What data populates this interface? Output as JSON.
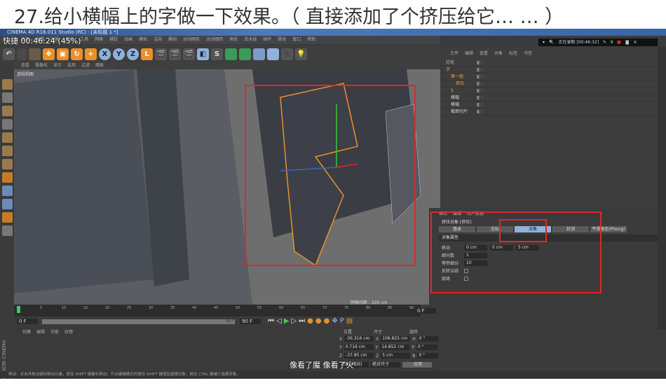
{
  "caption": "27.给小横幅上的字做一下效果。（ 直接添加了个挤压给它… … ）",
  "window_title": "CINEMA 4D R16.011 Studio (RC) - [未标题 1 *]",
  "overlay": "快捷  00:46:24 (45%)",
  "menu": [
    "文件",
    "编辑",
    "创建",
    "选择",
    "工具",
    "网格",
    "捕捉",
    "动画",
    "模拟",
    "渲染",
    "雕刻",
    "运动图形",
    "运动跟踪",
    "角色",
    "流水线",
    "插件",
    "脚本",
    "窗口",
    "帮助"
  ],
  "recording": {
    "label": "正在录制 [00:46:32]"
  },
  "viewport": {
    "menu": [
      "查看",
      "摄像机",
      "显示",
      "选项",
      "过滤",
      "面板"
    ],
    "label": "透视视图",
    "grid": "网格间距 : 100 cm"
  },
  "object_manager": {
    "menu": [
      "文件",
      "编辑",
      "查看",
      "对象",
      "标签",
      "书签"
    ],
    "objects": [
      {
        "name": "灯光",
        "indent": 0
      },
      {
        "name": "字",
        "indent": 0,
        "selected": true
      },
      {
        "name": "第一组",
        "indent": 1,
        "selected": true
      },
      {
        "name": "挤压",
        "indent": 2,
        "selected": true
      },
      {
        "name": "1",
        "indent": 1
      },
      {
        "name": "横幅",
        "indent": 1
      },
      {
        "name": "横幅",
        "indent": 1
      },
      {
        "name": "截面切片",
        "indent": 1
      }
    ]
  },
  "attributes": {
    "menu": [
      "模式",
      "编辑",
      "用户数据"
    ],
    "title": "挤压对象 [挤压]",
    "tabs": [
      {
        "label": "基本"
      },
      {
        "label": "坐标"
      },
      {
        "label": "对象",
        "active": true
      },
      {
        "label": "封顶"
      },
      {
        "label": "平滑着色(Phong)"
      }
    ],
    "section": "对象属性",
    "move_label": "移动",
    "move": [
      "0 cm",
      "0 cm",
      "5 cm"
    ],
    "subdiv_label": "细分数",
    "subdiv": "1",
    "iso_label": "等参细分",
    "iso": "10",
    "flip_label": "反转法线",
    "hier_label": "层级"
  },
  "timeline": {
    "ticks": [
      "0",
      "5",
      "10",
      "15",
      "20",
      "25",
      "30",
      "35",
      "40",
      "45",
      "50",
      "55",
      "60",
      "65",
      "70",
      "75",
      "80",
      "85",
      "90"
    ],
    "current": "0 F",
    "start": "0 F",
    "end": "90 F",
    "range_end": "90 F"
  },
  "material": {
    "menu": [
      "创建",
      "编辑",
      "功能",
      "纹理"
    ]
  },
  "coordinates": {
    "headers": [
      "位置",
      "尺寸",
      "旋转"
    ],
    "rows": [
      {
        "axis": "X",
        "pos": "-36.316 cm",
        "size": "106.825 cm",
        "rot_axis": "H",
        "rot": "0 °"
      },
      {
        "axis": "Y",
        "pos": "0.716 cm",
        "size": "14.852 cm",
        "rot_axis": "P",
        "rot": "0 °"
      },
      {
        "axis": "Z",
        "pos": "-37.85 cm",
        "size": "5 cm",
        "rot_axis": "B",
        "rot": "0 °"
      }
    ],
    "mode": "对象 (相对)",
    "size_mode": "绝对尺寸",
    "apply": "应用"
  },
  "status": "移动：点击并拖动鼠标移动元素。按住 SHIFT 键量化移动；节点编辑模式时按住 SHIFT 键增加选择对象；按住 CTRL 键减少选择对象。",
  "subtitle": "像看了魔 像看了火",
  "brand": "MAXON CINEMA 4D",
  "colors": {
    "accent": "#e9902b",
    "highlight_box": "#e0262b",
    "active_tab": "#8fb1dc"
  }
}
